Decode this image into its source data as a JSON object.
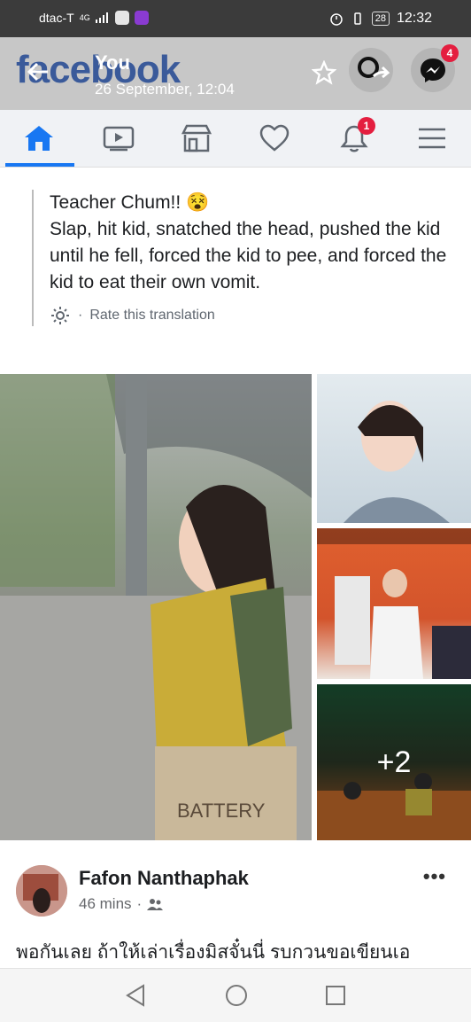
{
  "status_bar": {
    "carrier": "dtac-T",
    "network": "4G",
    "battery": "28",
    "time": "12:32"
  },
  "top_bar": {
    "logo_text": "facebook",
    "title": "You",
    "datetime": "26 September, 12:04",
    "messenger_badge": "4"
  },
  "nav": {
    "notifications_badge": "1",
    "icons": [
      "home-icon",
      "video-icon",
      "marketplace-icon",
      "dating-heart-icon",
      "notifications-bell-icon",
      "menu-icon"
    ]
  },
  "post": {
    "text_line1": "Teacher Chum!! 😵",
    "text_body": "Slap, hit kid, snatched the head, pushed the kid until he fell, forced the kid to pee, and forced the kid to eat their own vomit.",
    "rate_label": "Rate this translation",
    "more_photos": "+2"
  },
  "comment": {
    "author": "Fafon Nanthaphak",
    "time": "46 mins",
    "text": "พอกันเลย ถ้าให้เล่าเรื่องมิสจั๋นนี่ รบกวนขอเขียนเอ"
  },
  "colors": {
    "accent": "#1877f2",
    "badge": "#e41e3f",
    "status_bar": "#3b3b3b",
    "top_bar": "#c7c7c7"
  }
}
